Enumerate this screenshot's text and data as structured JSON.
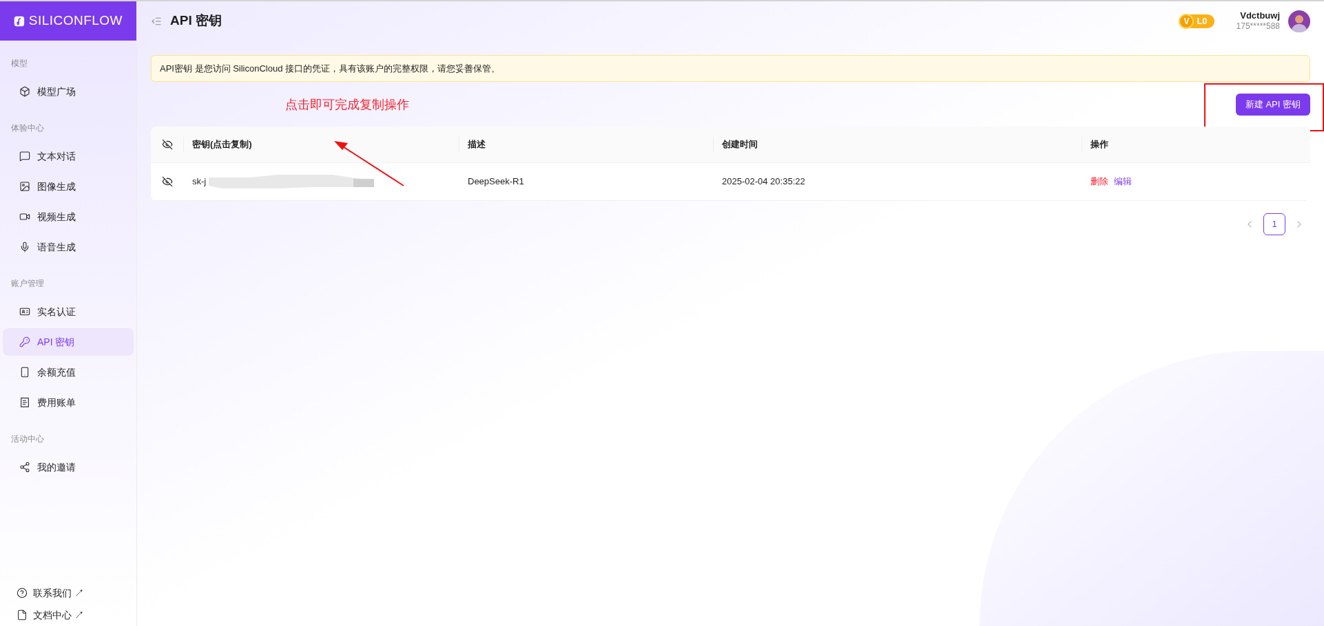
{
  "logo": {
    "text": "SILICONFLOW"
  },
  "sidebar": {
    "groups": [
      {
        "label": "模型",
        "items": [
          {
            "label": "模型广场",
            "selected": false
          }
        ]
      },
      {
        "label": "体验中心",
        "items": [
          {
            "label": "文本对话",
            "selected": false
          },
          {
            "label": "图像生成",
            "selected": false
          },
          {
            "label": "视频生成",
            "selected": false
          },
          {
            "label": "语音生成",
            "selected": false
          }
        ]
      },
      {
        "label": "账户管理",
        "items": [
          {
            "label": "实名认证",
            "selected": false
          },
          {
            "label": "API 密钥",
            "selected": true
          },
          {
            "label": "余额充值",
            "selected": false
          },
          {
            "label": "费用账单",
            "selected": false
          }
        ]
      },
      {
        "label": "活动中心",
        "items": [
          {
            "label": "我的邀请",
            "selected": false
          }
        ]
      }
    ],
    "footer_links": [
      {
        "label": "联系我们",
        "arrow": "↗"
      },
      {
        "label": "文档中心",
        "arrow": "↗"
      }
    ]
  },
  "header": {
    "title": "API 密钥",
    "badge": {
      "icon_letter": "V",
      "level": "L0"
    },
    "user": {
      "name": "Vdctbuwj",
      "phone": "175*****588"
    }
  },
  "notice": "API密钥 是您访问 SiliconCloud 接口的凭证，具有该账户的完整权限，请您妥善保管。",
  "annotation": {
    "text": "点击即可完成复制操作"
  },
  "new_key_button": "新建 API 密钥",
  "table": {
    "columns": [
      "密钥(点击复制)",
      "描述",
      "创建时间",
      "操作"
    ],
    "rows": [
      {
        "key": "sk-j",
        "redacted": true,
        "description": "DeepSeek-R1",
        "created": "2025-02-04 20:35:22",
        "actions": [
          {
            "label": "删除",
            "kind": "danger"
          },
          {
            "label": "编辑",
            "kind": "link"
          }
        ]
      }
    ]
  },
  "pagination": {
    "pages": [
      {
        "label": "1",
        "selected": true
      }
    ]
  }
}
